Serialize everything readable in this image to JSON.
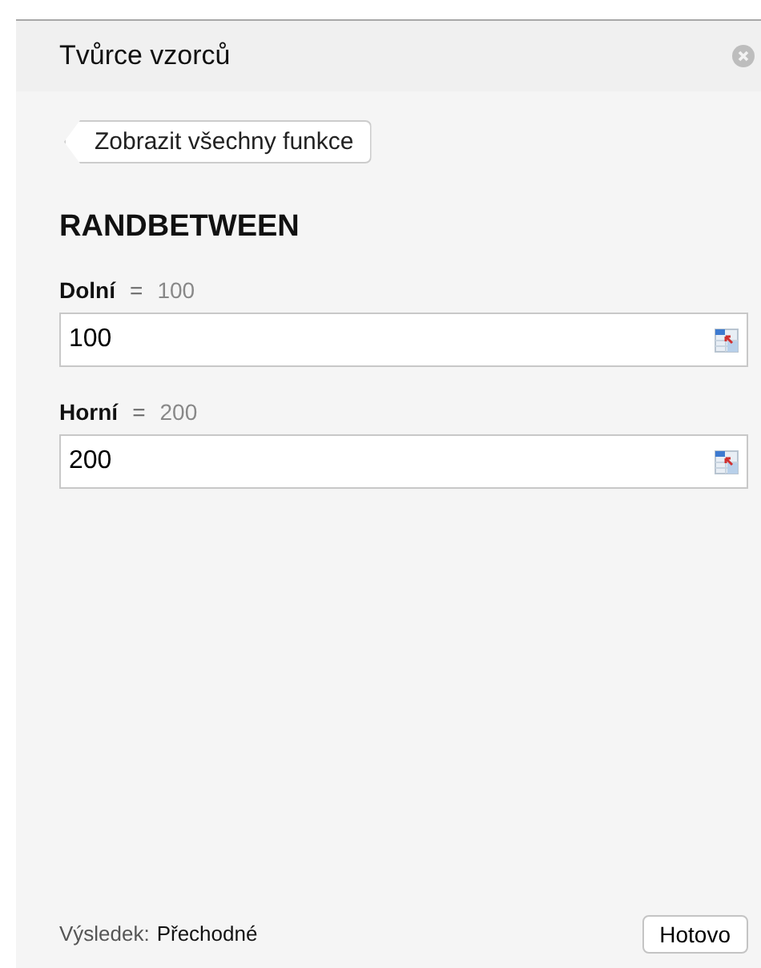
{
  "panel": {
    "title": "Tvůrce vzorců"
  },
  "back_button": {
    "label": "Zobrazit všechny funkce"
  },
  "function_name": "RANDBETWEEN",
  "arguments": [
    {
      "name": "Dolní",
      "equals": "=",
      "evaluated": "100",
      "value": "100"
    },
    {
      "name": "Horní",
      "equals": "=",
      "evaluated": "200",
      "value": "200"
    }
  ],
  "footer": {
    "result_label": "Výsledek:",
    "result_value": "Přechodné",
    "done_button": "Hotovo"
  }
}
